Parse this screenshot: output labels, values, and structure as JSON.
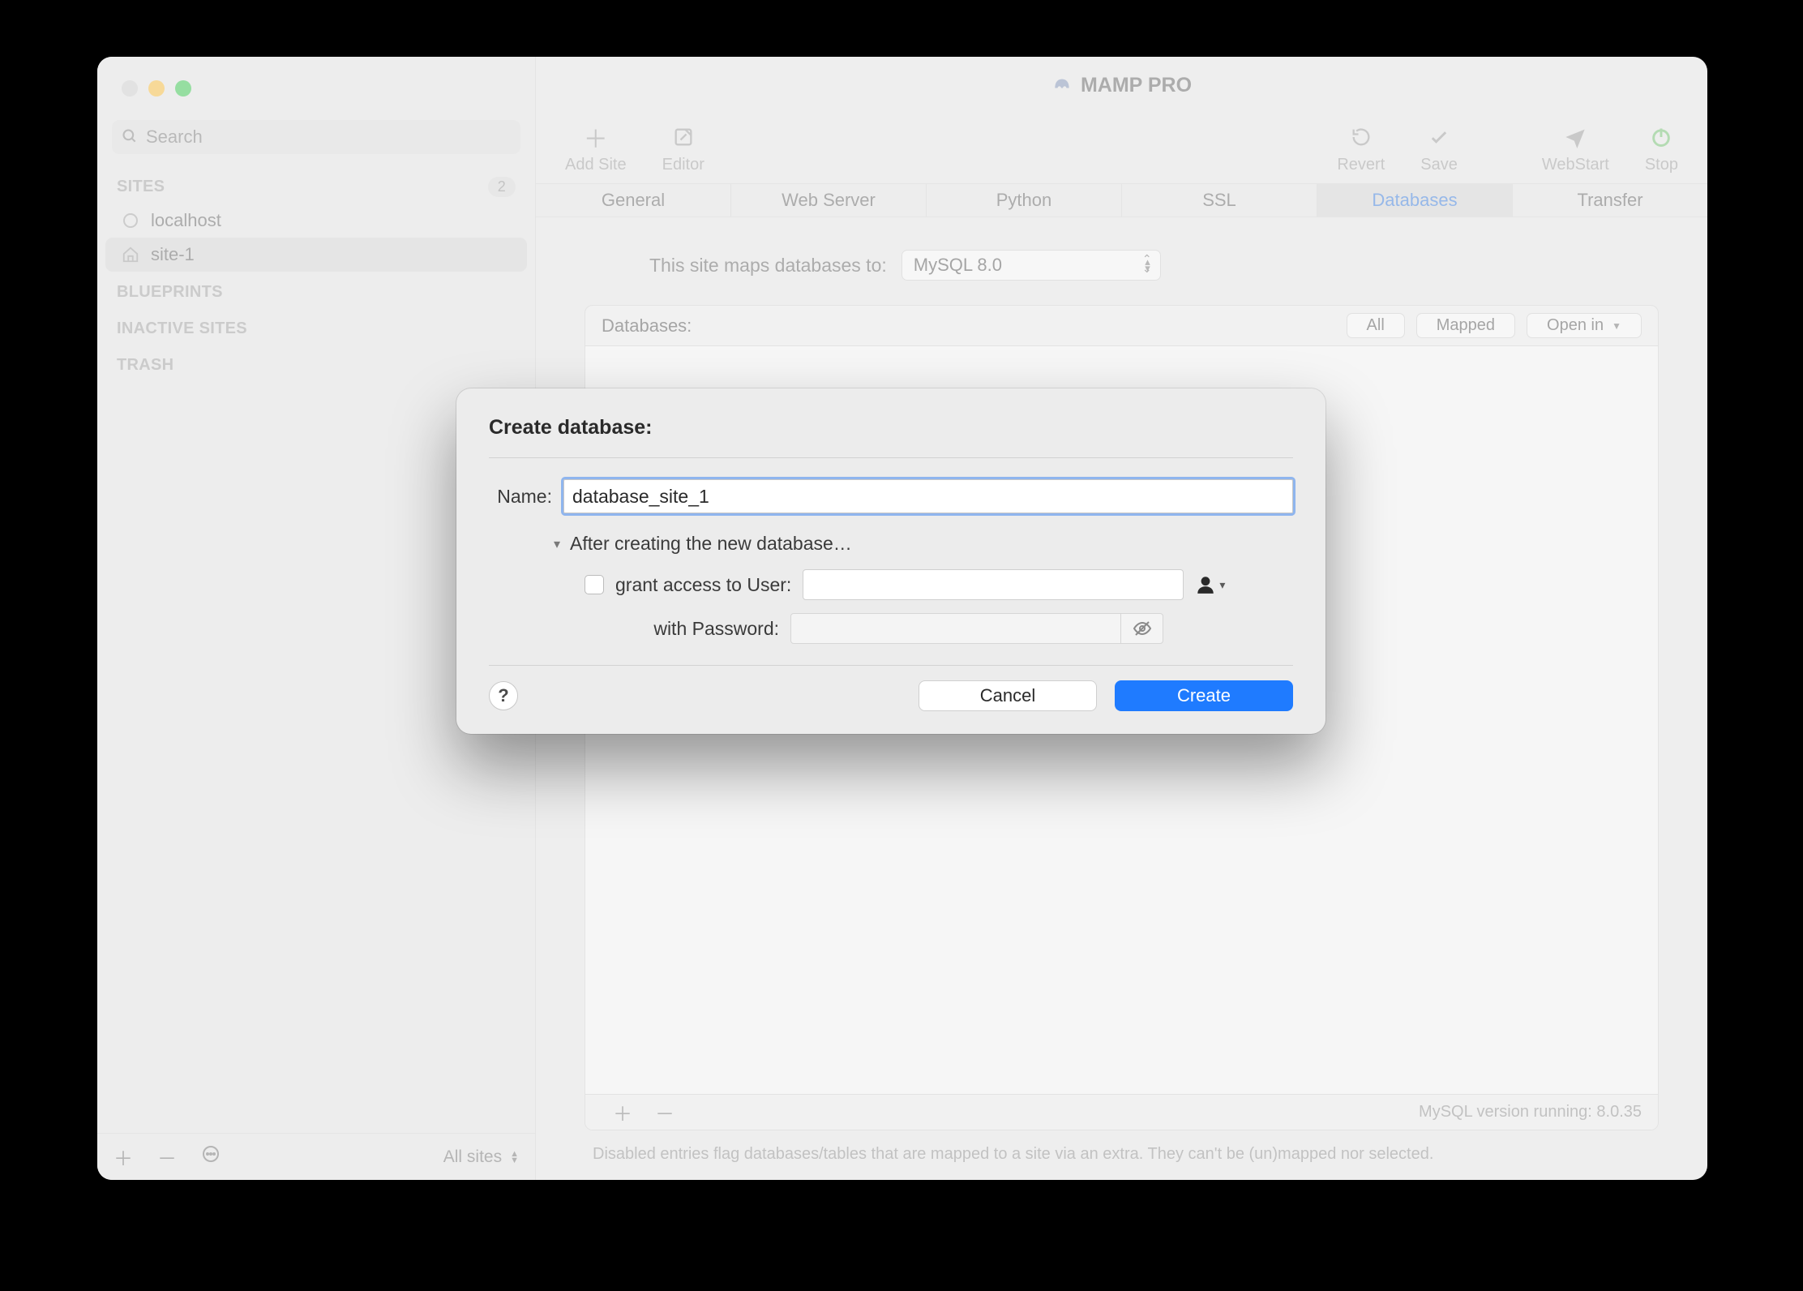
{
  "window": {
    "title": "MAMP PRO"
  },
  "sidebar": {
    "search_placeholder": "Search",
    "sections": {
      "sites": {
        "label": "SITES",
        "count": "2"
      },
      "blueprints": {
        "label": "BLUEPRINTS"
      },
      "inactive": {
        "label": "INACTIVE SITES"
      },
      "trash": {
        "label": "TRASH"
      }
    },
    "sites": [
      {
        "name": "localhost"
      },
      {
        "name": "site-1"
      }
    ],
    "footer_select": "All sites"
  },
  "toolbar": {
    "add_site": "Add Site",
    "editor": "Editor",
    "revert": "Revert",
    "save": "Save",
    "webstart": "WebStart",
    "stop": "Stop"
  },
  "tabs": [
    "General",
    "Web Server",
    "Python",
    "SSL",
    "Databases",
    "Transfer"
  ],
  "content": {
    "map_label": "This site maps databases to:",
    "mysql_select": "MySQL 8.0",
    "db_header": "Databases:",
    "seg_all": "All",
    "seg_mapped": "Mapped",
    "open_in": "Open in",
    "version": "MySQL version running: 8.0.35",
    "hint": "Disabled entries flag databases/tables that are mapped to a site via an extra. They can't be (un)mapped nor selected."
  },
  "modal": {
    "title": "Create database:",
    "name_label": "Name:",
    "name_value": "database_site_1",
    "after_label": "After creating the new database…",
    "grant_label": "grant access to User:",
    "password_label": "with Password:",
    "cancel": "Cancel",
    "create": "Create"
  }
}
